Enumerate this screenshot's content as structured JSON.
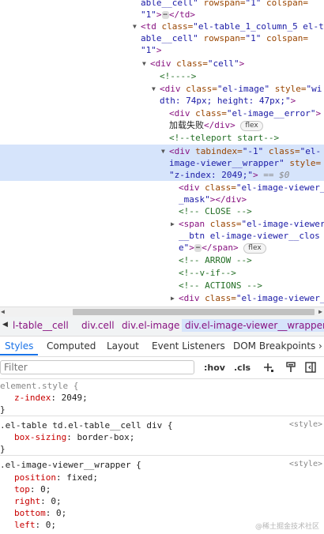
{
  "elements_tree": {
    "l1": {
      "a": "able__cell\"",
      "b": " rowspan=",
      "c": "\"1\"",
      "d": " colspan="
    },
    "l2": {
      "a": "\"1\"",
      "b": ">",
      "c": "</td>"
    },
    "l3": {
      "a": "<td",
      "b": " class=",
      "c": "\"el-table_1_column_5 el-t"
    },
    "l4": {
      "a": "able__cell\"",
      "b": " rowspan=",
      "c": "\"1\"",
      "d": " colspan="
    },
    "l5": {
      "a": "\"1\"",
      "b": ">"
    },
    "l6": {
      "a": "<div",
      "b": " class=",
      "c": "\"cell\"",
      "d": ">"
    },
    "l7": {
      "a": "<!---->"
    },
    "l8": {
      "a": "<div",
      "b": " class=",
      "c": "\"el-image\"",
      "d": " style=",
      "e": "\"wi"
    },
    "l9": {
      "a": "dth: 74px; height: 47px;\"",
      "b": ">"
    },
    "l10": {
      "a": "<div",
      "b": " class=",
      "c": "\"el-image__error\"",
      "d": ">"
    },
    "l11": {
      "a": "加载失败",
      "b": "</div>",
      "c": "flex"
    },
    "l12": {
      "a": "<!--teleport start-->"
    },
    "l13": {
      "a": "<div",
      "b": " tabindex=",
      "c": "\"-1\"",
      "d": " class=",
      "e": "\"el-"
    },
    "l14": {
      "a": "image-viewer__wrapper\"",
      "b": " style="
    },
    "l15": {
      "a": "\"z-index: 2049;\"",
      "b": ">",
      "c": "== $0"
    },
    "l16": {
      "a": "<div",
      "b": " class=",
      "c": "\"el-image-viewer_"
    },
    "l17": {
      "a": "_mask\"",
      "b": "></div>"
    },
    "l18": {
      "a": "<!-- CLOSE -->"
    },
    "l19": {
      "a": "<span",
      "b": " class=",
      "c": "\"el-image-viewer"
    },
    "l20": {
      "a": "__btn el-image-viewer__clos"
    },
    "l21": {
      "a": "e\"",
      "b": ">",
      "c": "</span>",
      "d": "flex"
    },
    "l22": {
      "a": "<!-- ARROW -->"
    },
    "l23": {
      "a": "<!--v-if-->"
    },
    "l24": {
      "a": "<!-- ACTIONS -->"
    },
    "l25": {
      "a": "<div",
      "b": " class=",
      "c": "\"el-image-viewer_"
    },
    "ellipsis": "⋯"
  },
  "breadcrumbs": [
    "l-table__cell",
    "div.cell",
    "div.el-image",
    "div.el-image-viewer__wrapper"
  ],
  "tabs": [
    "Styles",
    "Computed",
    "Layout",
    "Event Listeners",
    "DOM Breakpoints"
  ],
  "filter": {
    "placeholder": "Filter",
    "hov": ":hov",
    "cls": ".cls"
  },
  "styles": {
    "rule1": {
      "selector": "element.style {",
      "props": [
        {
          "name": "z-index",
          "value": "2049;"
        }
      ],
      "close": "}"
    },
    "rule2": {
      "selector": ".el-table td.el-table__cell div {",
      "source": "<style>",
      "props": [
        {
          "name": "box-sizing",
          "value": "border-box;"
        }
      ],
      "close": "}"
    },
    "rule3": {
      "selector": ".el-image-viewer__wrapper {",
      "source": "<style>",
      "props": [
        {
          "name": "position",
          "value": "fixed;"
        },
        {
          "name": "top",
          "value": "0;"
        },
        {
          "name": "right",
          "value": "0;"
        },
        {
          "name": "bottom",
          "value": "0;"
        },
        {
          "name": "left",
          "value": "0;"
        }
      ]
    }
  },
  "watermark": "@稀土掘金技术社区",
  "colors": {
    "tag": "#881280",
    "attr": "#994500",
    "value": "#1a1aa6",
    "comment": "#236e25",
    "accent": "#1a73e8",
    "selected_row": "#d6e4fb",
    "property": "#c80000"
  }
}
